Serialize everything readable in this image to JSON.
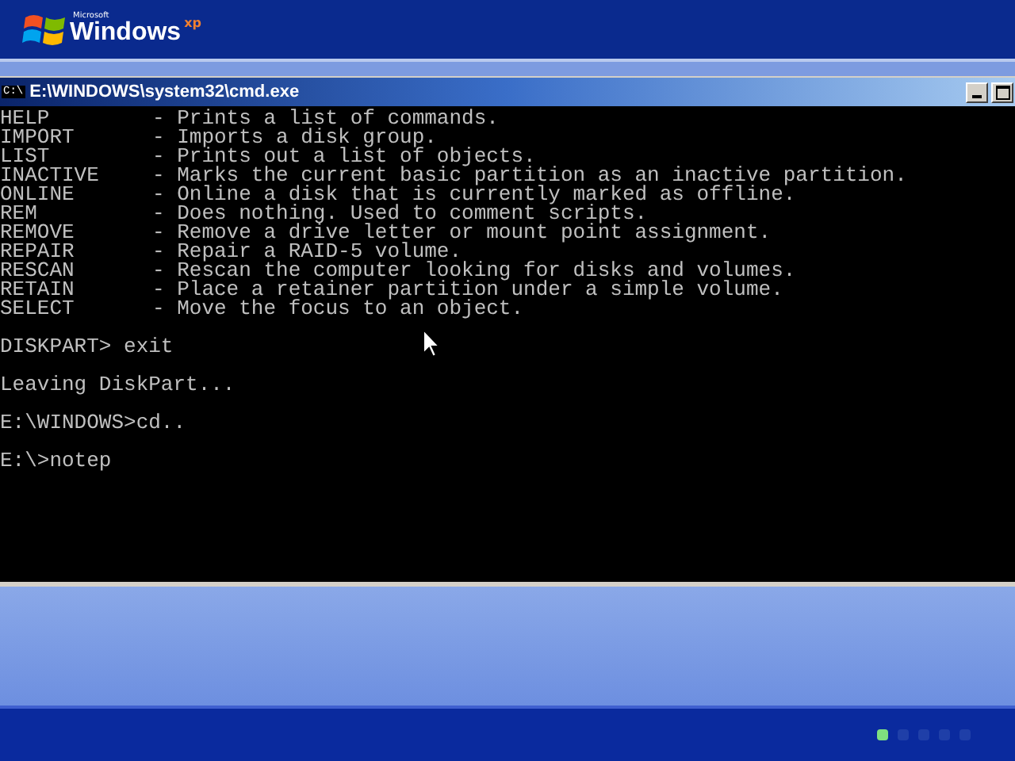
{
  "logo": {
    "maker": "Microsoft",
    "name": "Windows",
    "edition": "xp"
  },
  "window": {
    "title": "E:\\WINDOWS\\system32\\cmd.exe",
    "icon_text": "C:\\"
  },
  "console": {
    "lines": [
      {
        "kind": "command",
        "name": "HELP",
        "description": "- Prints a list of commands."
      },
      {
        "kind": "command",
        "name": "IMPORT",
        "description": "- Imports a disk group."
      },
      {
        "kind": "command",
        "name": "LIST",
        "description": "- Prints out a list of objects."
      },
      {
        "kind": "command",
        "name": "INACTIVE",
        "description": "- Marks the current basic partition as an inactive partition."
      },
      {
        "kind": "command",
        "name": "ONLINE",
        "description": "- Online a disk that is currently marked as offline."
      },
      {
        "kind": "command",
        "name": "REM",
        "description": "- Does nothing. Used to comment scripts."
      },
      {
        "kind": "command",
        "name": "REMOVE",
        "description": "- Remove a drive letter or mount point assignment."
      },
      {
        "kind": "command",
        "name": "REPAIR",
        "description": "- Repair a RAID-5 volume."
      },
      {
        "kind": "command",
        "name": "RESCAN",
        "description": "- Rescan the computer looking for disks and volumes."
      },
      {
        "kind": "command",
        "name": "RETAIN",
        "description": "- Place a retainer partition under a simple volume."
      },
      {
        "kind": "command",
        "name": "SELECT",
        "description": "- Move the focus to an object."
      },
      {
        "kind": "output",
        "text": "DISKPART> exit"
      },
      {
        "kind": "output",
        "text": "Leaving DiskPart..."
      },
      {
        "kind": "output",
        "text": "E:\\WINDOWS>cd.."
      },
      {
        "kind": "output",
        "text": "E:\\>notep"
      }
    ]
  },
  "progress_dots": [
    {
      "on": true
    },
    {
      "on": false
    },
    {
      "on": false
    },
    {
      "on": false
    },
    {
      "on": false
    }
  ]
}
